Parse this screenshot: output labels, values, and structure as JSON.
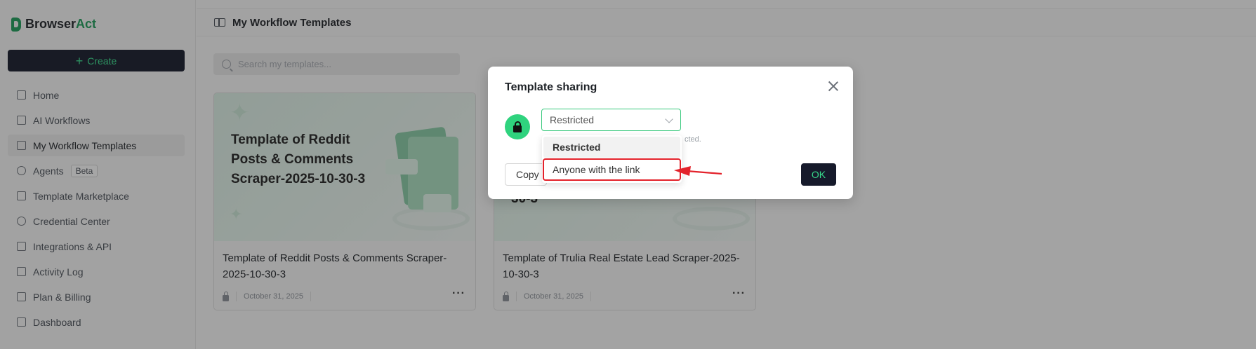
{
  "brand": {
    "name_part1": "Browser",
    "name_part2": "Act"
  },
  "sidebar": {
    "create_label": "Create",
    "items": [
      {
        "label": "Home",
        "icon": "home-icon"
      },
      {
        "label": "AI Workflows",
        "icon": "workflow-icon"
      },
      {
        "label": "My Workflow Templates",
        "icon": "templates-icon",
        "active": true
      },
      {
        "label": "Agents",
        "icon": "agents-icon",
        "badge": "Beta"
      },
      {
        "label": "Template Marketplace",
        "icon": "marketplace-icon"
      },
      {
        "label": "Credential Center",
        "icon": "credential-icon"
      },
      {
        "label": "Integrations & API",
        "icon": "integrations-icon"
      },
      {
        "label": "Activity Log",
        "icon": "activity-log-icon"
      },
      {
        "label": "Plan & Billing",
        "icon": "billing-icon"
      },
      {
        "label": "Dashboard",
        "icon": "dashboard-icon"
      }
    ]
  },
  "header": {
    "title": "My Workflow Templates"
  },
  "search": {
    "placeholder": "Search my templates..."
  },
  "cards": [
    {
      "thumb_title": "Template of Reddit Posts & Comments Scraper-2025-10-30-3",
      "title": "Template of Reddit Posts & Comments Scraper-2025-10-30-3",
      "date": "October 31, 2025",
      "more": "···"
    },
    {
      "thumb_title": "30-3",
      "title": "Template of Trulia Real Estate Lead Scraper-2025-10-30-3",
      "date": "October 31, 2025",
      "more": "···"
    }
  ],
  "modal": {
    "title": "Template sharing",
    "selected": "Restricted",
    "hint": "cted.",
    "copy_label": "Copy",
    "ok_label": "OK",
    "options": [
      "Restricted",
      "Anyone with the link"
    ]
  },
  "colors": {
    "accent": "#37d98a",
    "dark": "#161a2b",
    "annotation": "#e3222b"
  }
}
